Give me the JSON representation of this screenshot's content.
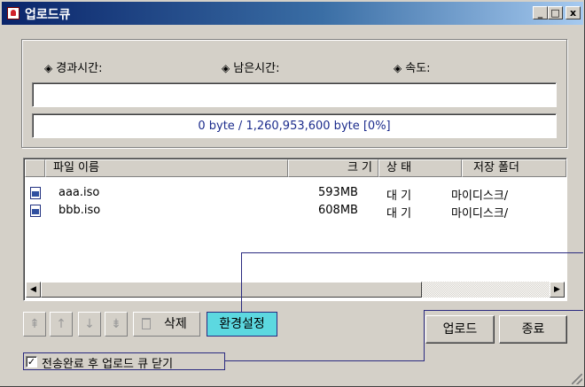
{
  "window": {
    "title": "업로드큐"
  },
  "titlebar_buttons": {
    "minimize": "_",
    "maximize": "□",
    "close": "x"
  },
  "stats": {
    "elapsed_label": "경과시간:",
    "remaining_label": "남은시간:",
    "speed_label": "속도:",
    "bullet": "◈"
  },
  "progress": {
    "text": "0 byte / 1,260,953,600 byte [0%]",
    "fraction": 0
  },
  "file_list": {
    "columns": [
      "파일 이름",
      "크 기",
      "상 태",
      "저장 폴더"
    ],
    "rows": [
      {
        "name": "aaa.iso",
        "size": "593MB",
        "status": "대 기",
        "folder": "마이디스크/"
      },
      {
        "name": "bbb.iso",
        "size": "608MB",
        "status": "대 기",
        "folder": "마이디스크/"
      }
    ]
  },
  "scrollbar": {
    "left_arrow": "◀",
    "right_arrow": "▶"
  },
  "toolbar": {
    "move_top": "⇞",
    "move_up": "↑",
    "move_down": "↓",
    "move_bottom": "⇟",
    "delete_label": "삭제",
    "settings_label": "환경설정"
  },
  "actions": {
    "upload_label": "업로드",
    "exit_label": "종료"
  },
  "close_option": {
    "label": "전송완료 후 업로드 큐 닫기",
    "checked": true,
    "mark": "✓"
  }
}
